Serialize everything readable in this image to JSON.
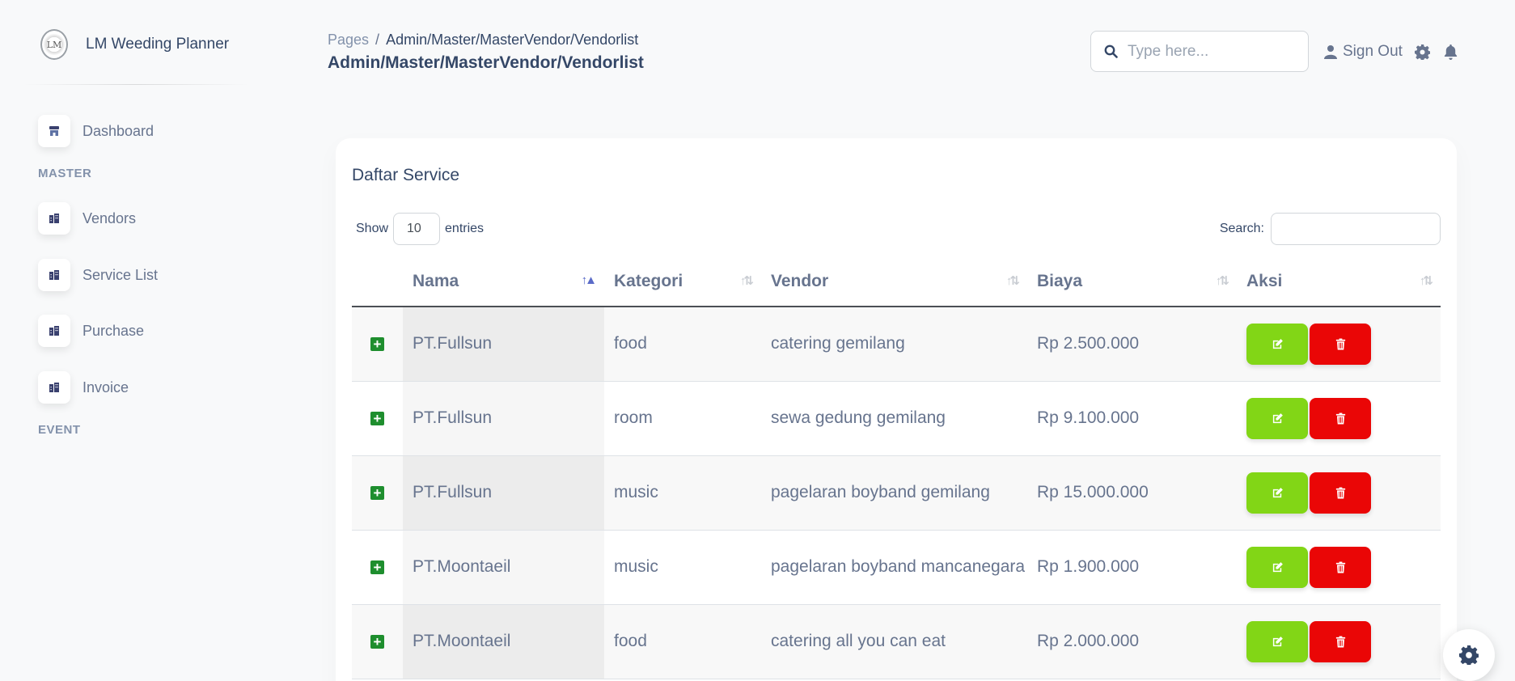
{
  "brand": {
    "name": "LM Weeding Planner",
    "logo_text": "LM"
  },
  "sidebar": {
    "dashboard": "Dashboard",
    "section_master": "MASTER",
    "items": [
      "Vendors",
      "Service List",
      "Purchase",
      "Invoice"
    ],
    "section_event": "EVENT"
  },
  "header": {
    "breadcrumb_root": "Pages",
    "breadcrumb_sep": "/",
    "breadcrumb_current": "Admin/Master/MasterVendor/Vendorlist",
    "title": "Admin/Master/MasterVendor/Vendorlist",
    "search_placeholder": "Type here...",
    "signout_label": "Sign Out"
  },
  "card": {
    "title": "Daftar Service",
    "show_label": "Show",
    "entries_value": "10",
    "entries_label": "entries",
    "search_label": "Search:"
  },
  "table": {
    "columns": [
      "Nama",
      "Kategori",
      "Vendor",
      "Biaya",
      "Aksi"
    ],
    "sorted_column": "Nama",
    "rows": [
      {
        "nama": "PT.Fullsun",
        "kategori": "food",
        "vendor": "catering gemilang",
        "biaya": "Rp 2.500.000"
      },
      {
        "nama": "PT.Fullsun",
        "kategori": "room",
        "vendor": "sewa gedung gemilang",
        "biaya": "Rp 9.100.000"
      },
      {
        "nama": "PT.Fullsun",
        "kategori": "music",
        "vendor": "pagelaran boyband gemilang",
        "biaya": "Rp 15.000.000"
      },
      {
        "nama": "PT.Moontaeil",
        "kategori": "music",
        "vendor": "pagelaran boyband mancanegara",
        "biaya": "Rp 1.900.000"
      },
      {
        "nama": "PT.Moontaeil",
        "kategori": "food",
        "vendor": "catering all you can eat",
        "biaya": "Rp 2.000.000"
      }
    ]
  },
  "colors": {
    "edit_button": "#82d616",
    "delete_button": "#ea0606",
    "expand_icon": "#1e8e2e"
  }
}
